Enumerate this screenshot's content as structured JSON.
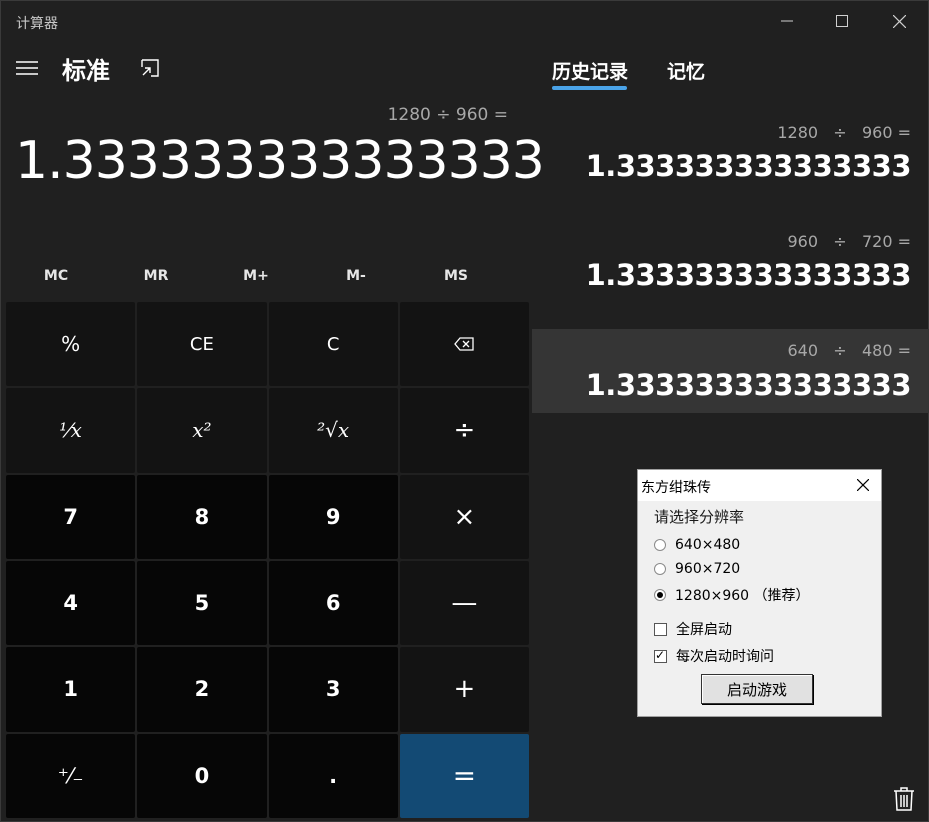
{
  "window": {
    "title": "计算器"
  },
  "header": {
    "mode_title": "标准"
  },
  "display": {
    "expression": "1280 ÷ 960 =",
    "result": "1.333333333333333"
  },
  "memory_buttons": [
    "MC",
    "MR",
    "M+",
    "M-",
    "MS"
  ],
  "keypad": {
    "percent": "%",
    "ce": "CE",
    "c": "C",
    "backspace_icon": "backspace-icon",
    "reciprocal": "¹⁄x",
    "square": "x²",
    "sqrt": "²√x",
    "divide": "÷",
    "n7": "7",
    "n8": "8",
    "n9": "9",
    "multiply": "×",
    "n4": "4",
    "n5": "5",
    "n6": "6",
    "minus": "—",
    "n1": "1",
    "n2": "2",
    "n3": "3",
    "plus": "+",
    "negate": "⁺⁄₋",
    "n0": "0",
    "decimal": ".",
    "equals": "="
  },
  "tabs": {
    "history": "历史记录",
    "memory": "记忆"
  },
  "history": [
    {
      "expression": "1280   ÷   960 =",
      "result": "1.333333333333333"
    },
    {
      "expression": "960   ÷   720 =",
      "result": "1.333333333333333"
    },
    {
      "expression": "640   ÷   480 =",
      "result": "1.333333333333333"
    }
  ],
  "dialog": {
    "title": "东方绀珠传",
    "prompt": "请选择分辨率",
    "options": [
      {
        "label": "640×480",
        "selected": false
      },
      {
        "label": "960×720",
        "selected": false
      },
      {
        "label": "1280×960 （推荐）",
        "selected": true
      }
    ],
    "fullscreen_label": "全屏启动",
    "fullscreen_checked": false,
    "ask_each_time_label": "每次启动时询问",
    "ask_each_time_checked": true,
    "start_button": "启动游戏"
  },
  "colors": {
    "background": "#202020",
    "accent": "#4aa3e8",
    "equals_key": "#134a74",
    "history_highlight": "#353535"
  }
}
